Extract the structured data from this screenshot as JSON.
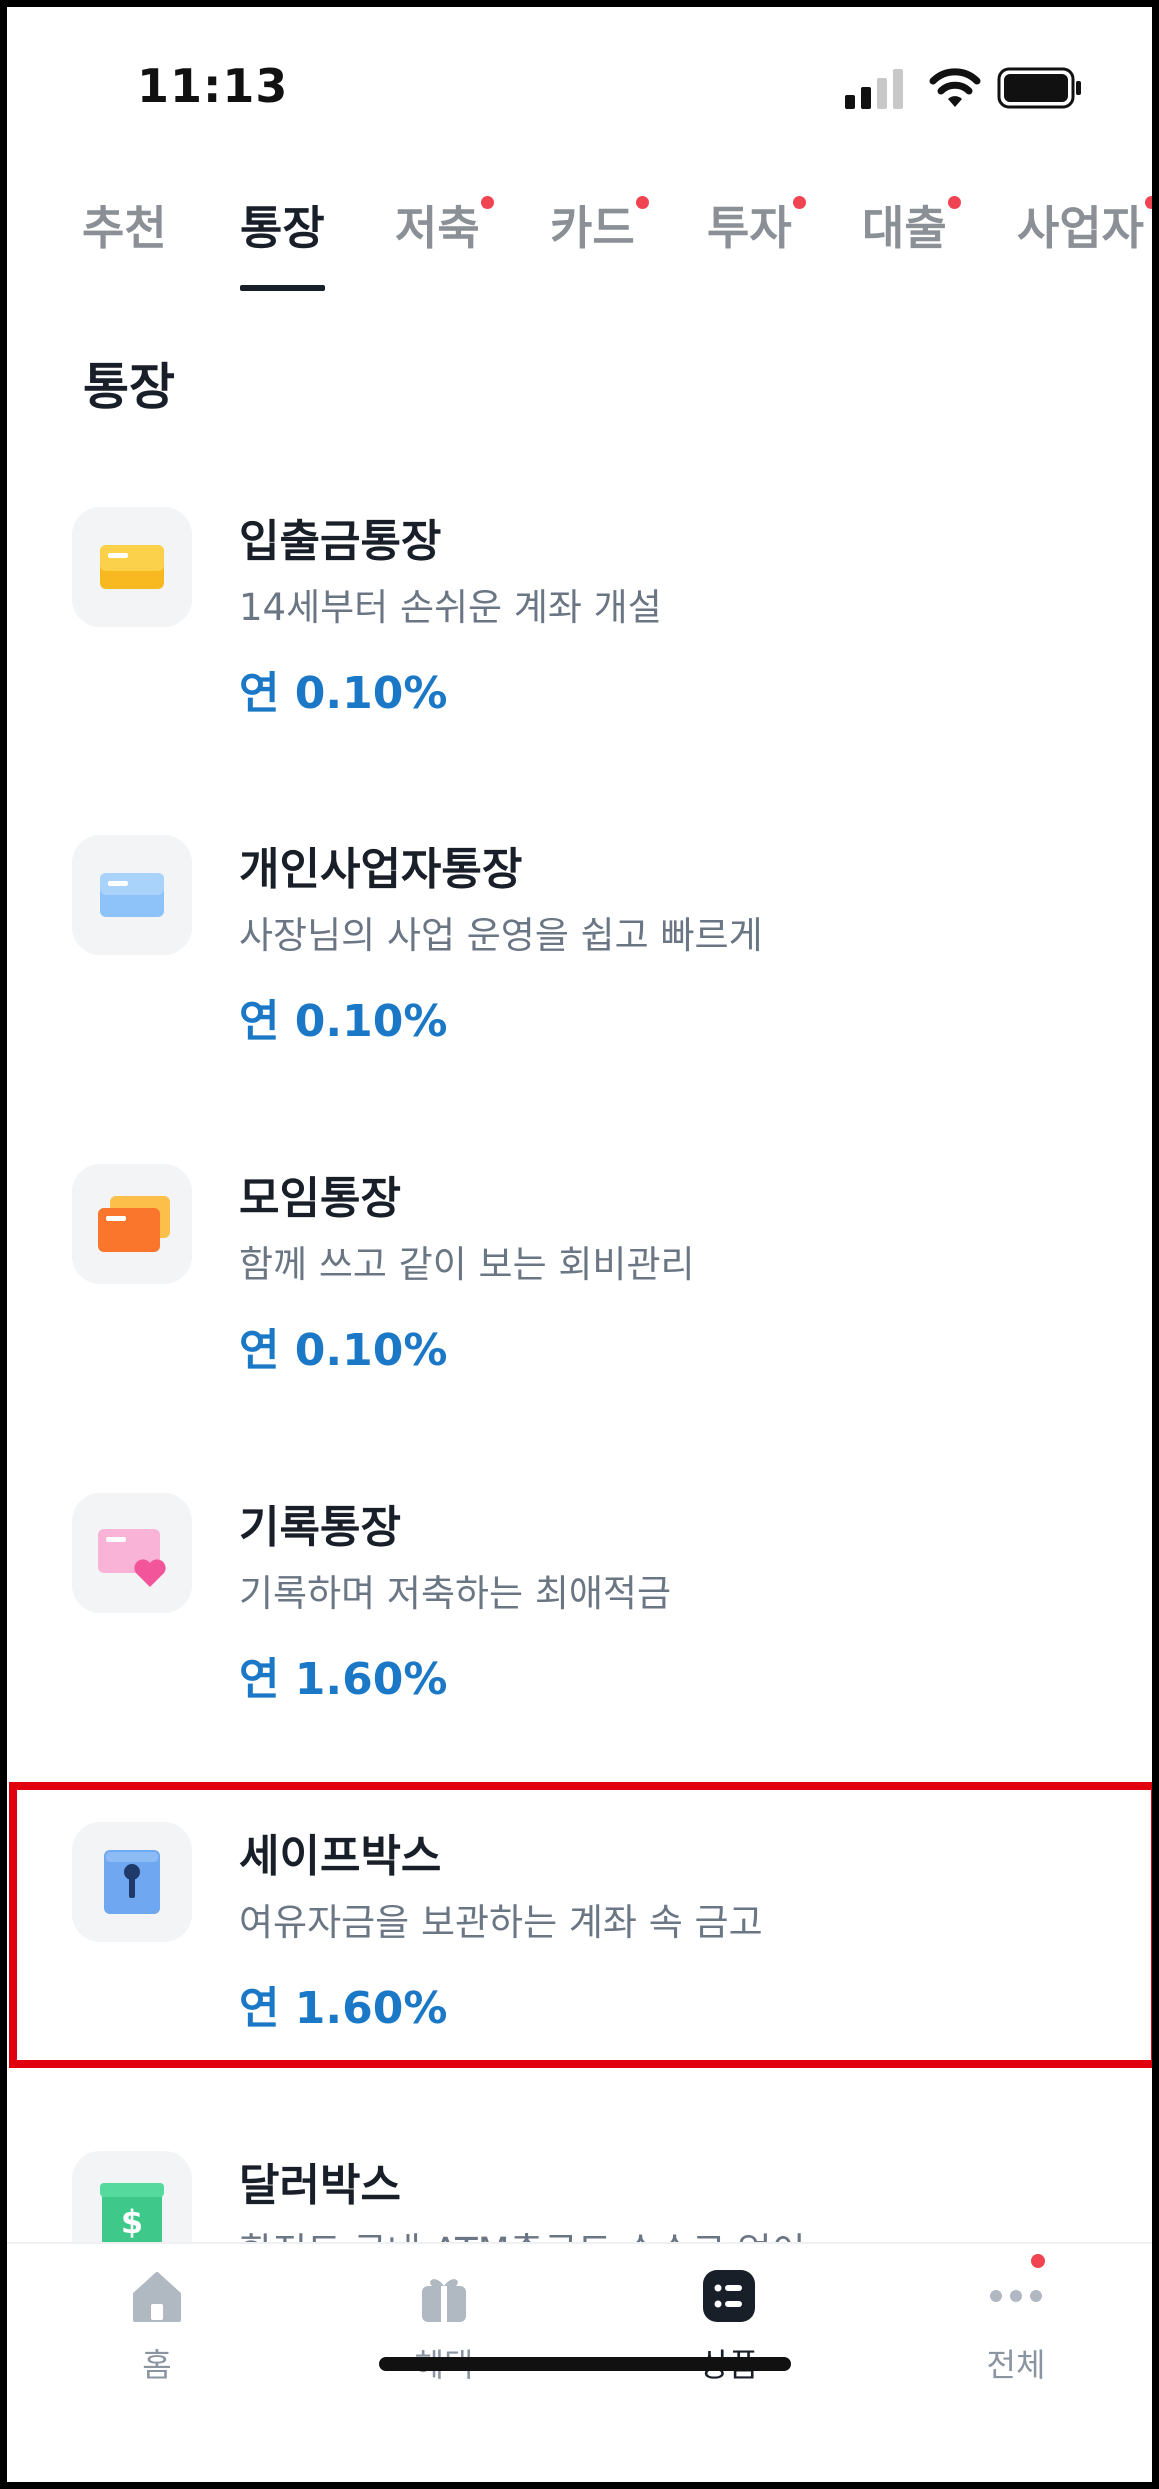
{
  "status_bar": {
    "time": "11:13"
  },
  "tabs": [
    {
      "label": "추천",
      "dot": false,
      "active": false
    },
    {
      "label": "통장",
      "dot": false,
      "active": true
    },
    {
      "label": "저축",
      "dot": true,
      "active": false
    },
    {
      "label": "카드",
      "dot": true,
      "active": false
    },
    {
      "label": "투자",
      "dot": true,
      "active": false
    },
    {
      "label": "대출",
      "dot": true,
      "active": false
    },
    {
      "label": "사업자",
      "dot": true,
      "active": false
    }
  ],
  "section": {
    "title": "통장"
  },
  "products": [
    {
      "name": "입출금통장",
      "desc": "14세부터 손쉬운 계좌 개설",
      "rate": "연 0.10%",
      "icon": "yellow-card-icon"
    },
    {
      "name": "개인사업자통장",
      "desc": "사장님의 사업 운영을 쉽고 빠르게",
      "rate": "연 0.10%",
      "icon": "blue-card-icon"
    },
    {
      "name": "모임통장",
      "desc": "함께 쓰고 같이 보는 회비관리",
      "rate": "연 0.10%",
      "icon": "orange-cards-icon"
    },
    {
      "name": "기록통장",
      "desc": "기록하며 저축하는 최애적금",
      "rate": "연 1.60%",
      "icon": "pink-heart-card-icon"
    },
    {
      "name": "세이프박스",
      "desc": "여유자금을 보관하는 계좌 속 금고",
      "rate": "연 1.60%",
      "icon": "safe-box-icon"
    },
    {
      "name": "달러박스",
      "desc": "환전도 국내 ATM출금도 수수료 없이",
      "rate": "",
      "icon": "dollar-box-icon"
    }
  ],
  "bottom_nav": [
    {
      "label": "홈",
      "icon": "home-icon",
      "active": false
    },
    {
      "label": "혜택",
      "icon": "gift-icon",
      "active": false
    },
    {
      "label": "상품",
      "icon": "products-icon",
      "active": true
    },
    {
      "label": "전체",
      "icon": "more-icon",
      "active": false
    }
  ],
  "colors": {
    "rate": "#1b78c7",
    "accent_dot": "#f04452",
    "highlight": "#e0000e"
  }
}
